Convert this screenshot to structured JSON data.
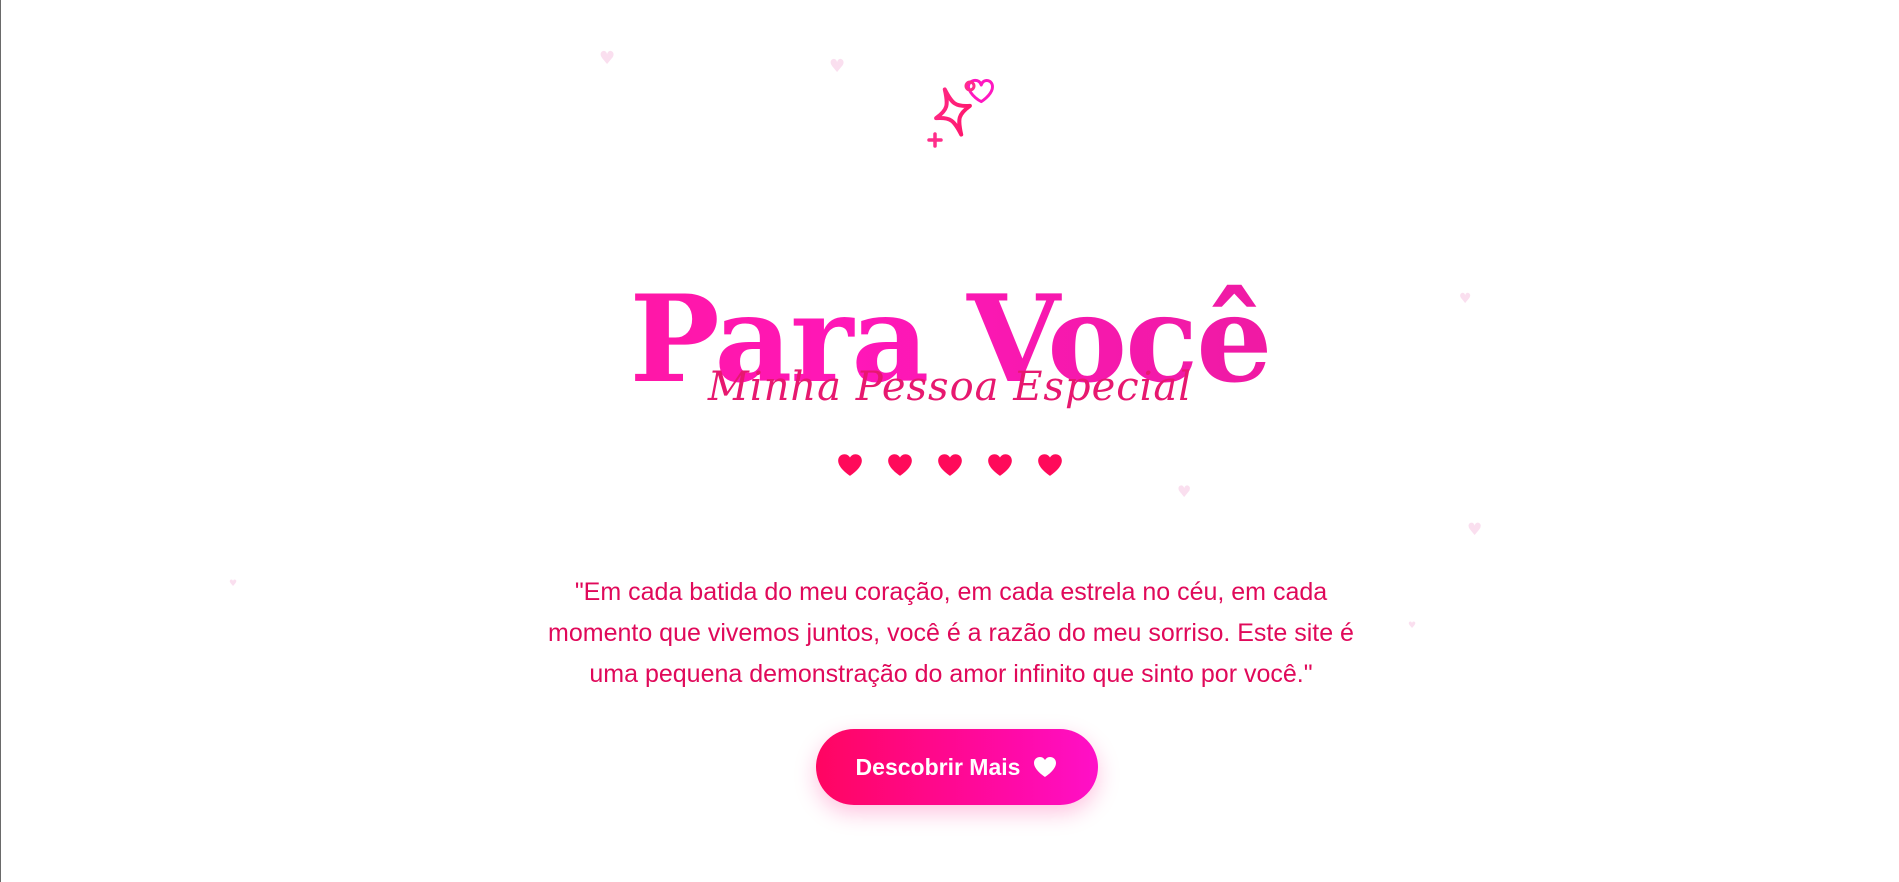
{
  "hero": {
    "title": "Para Você",
    "subtitle": "Minha Pessoa Especial",
    "quote": "\"Em cada batida do meu coração, em cada estrela no céu, em cada momento que vivemos juntos, você é a razão do meu sorriso. Este site é uma pequena demonstração do amor infinito que sinto por você.\"",
    "rating_hearts": 5,
    "cta_label": "Descobrir Mais",
    "cta_icon": "heart-icon",
    "top_icon": "sparkle-heart-icon"
  },
  "colors": {
    "accent": "#ff1676",
    "accent_secondary": "#ff17b8",
    "heart": "#ff0a5a",
    "quote_text": "#e0095a",
    "background": "#ffffff"
  }
}
